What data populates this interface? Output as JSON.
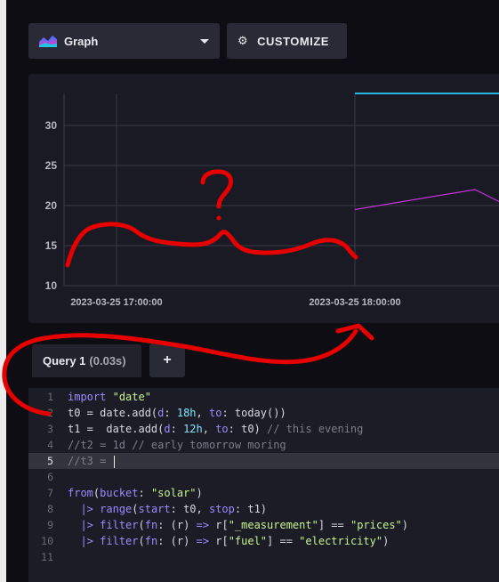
{
  "toolbar": {
    "graph_label": "Graph",
    "customize_label": "CUSTOMIZE"
  },
  "chart_data": {
    "type": "line",
    "yticks": [
      "30",
      "25",
      "20",
      "15",
      "10"
    ],
    "xticks": [
      "2023-03-25 17:00:00",
      "2023-03-25 18:00:00"
    ],
    "ylim": [
      10,
      34
    ],
    "grid": true,
    "series": [
      {
        "color": "#22b8e0",
        "values": [
          34
        ]
      },
      {
        "color": "#c533d8",
        "values": [
          19.5,
          22,
          20.5
        ]
      }
    ]
  },
  "query": {
    "tab_label": "Query 1",
    "tab_time": "(0.03s)",
    "add_label": "+"
  },
  "editor": {
    "line_numbers": [
      "1",
      "2",
      "3",
      "4",
      "5",
      "6",
      "7",
      "8",
      "9",
      "10",
      "11"
    ],
    "lines": [
      "import \"date\"",
      "t0 = date.add(d: 18h, to: today())",
      "t1 =  date.add(d: 12h, to: t0) // this evening",
      "//t2 = 1d // early tomorrow moring",
      "//t3 = ",
      "",
      "from(bucket: \"solar\")",
      "  |> range(start: t0, stop: t1)",
      "  |> filter(fn: (r) => r[\"_measurement\"] == \"prices\")",
      "  |> filter(fn: (r) => r[\"fuel\"] == \"electricity\")",
      ""
    ]
  },
  "annotation": {
    "mark": "?",
    "color": "#e60000"
  },
  "colors": {
    "background": "#0d0d13",
    "panel": "#1a1a24",
    "button": "#2a2a37"
  }
}
